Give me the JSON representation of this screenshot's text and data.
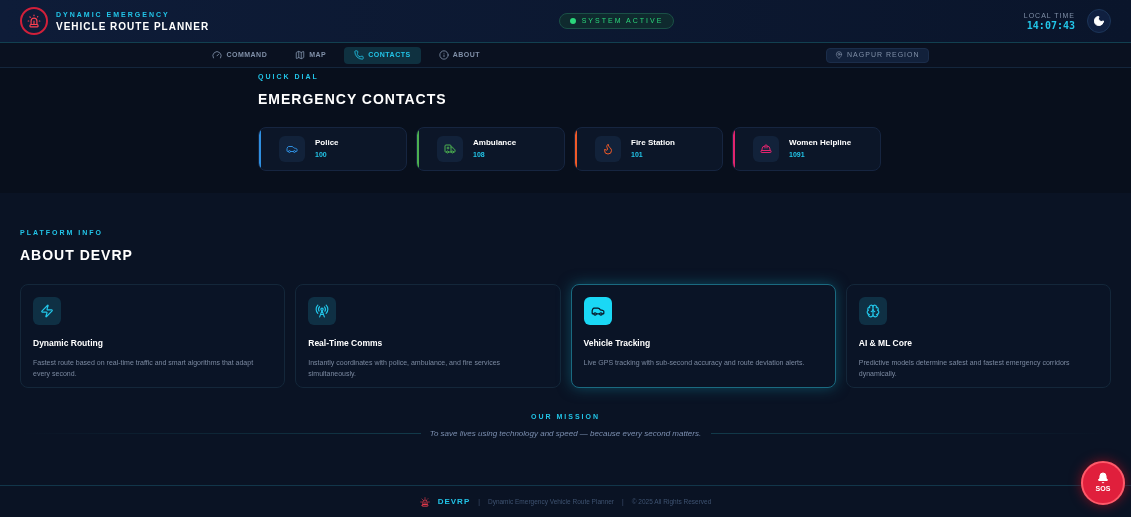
{
  "header": {
    "subtitle": "DYNAMIC EMERGENCY",
    "title": "VEHICLE ROUTE PLANNER",
    "status": "SYSTEM ACTIVE",
    "time_label": "LOCAL TIME",
    "time": "14:07:43"
  },
  "nav": {
    "tabs": [
      {
        "label": "COMMAND",
        "selected": false
      },
      {
        "label": "MAP",
        "selected": false
      },
      {
        "label": "CONTACTS",
        "selected": true
      },
      {
        "label": "ABOUT",
        "selected": false
      }
    ],
    "region": "NAGPUR REGION"
  },
  "contacts": {
    "eyebrow": "QUICK DIAL",
    "title": "EMERGENCY CONTACTS",
    "items": [
      {
        "name": "Police",
        "number": "100",
        "color": "#2f8fe0"
      },
      {
        "name": "Ambulance",
        "number": "108",
        "color": "#4caf50"
      },
      {
        "name": "Fire Station",
        "number": "101",
        "color": "#f05a28"
      },
      {
        "name": "Women Helpline",
        "number": "1091",
        "color": "#e0246e"
      }
    ]
  },
  "about": {
    "eyebrow": "PLATFORM INFO",
    "title": "ABOUT DEVRP",
    "features": [
      {
        "title": "Dynamic Routing",
        "text": "Fastest route based on real-time traffic and smart algorithms that adapt every second.",
        "selected": false
      },
      {
        "title": "Real-Time Comms",
        "text": "Instantly coordinates with police, ambulance, and fire services simultaneously.",
        "selected": false
      },
      {
        "title": "Vehicle Tracking",
        "text": "Live GPS tracking with sub-second accuracy and route deviation alerts.",
        "selected": true
      },
      {
        "title": "AI & ML Core",
        "text": "Predictive models determine safest and fastest emergency corridors dynamically.",
        "selected": false
      }
    ],
    "mission_label": "OUR MISSION",
    "mission": "To save lives using technology and speed — because every second matters."
  },
  "footer": {
    "brand": "DEVRP",
    "parts": [
      "Dynamic Emergency Vehicle Route Planner",
      "© 2025 All Rights Reserved"
    ],
    "separator": "|"
  },
  "sos": "SOS"
}
